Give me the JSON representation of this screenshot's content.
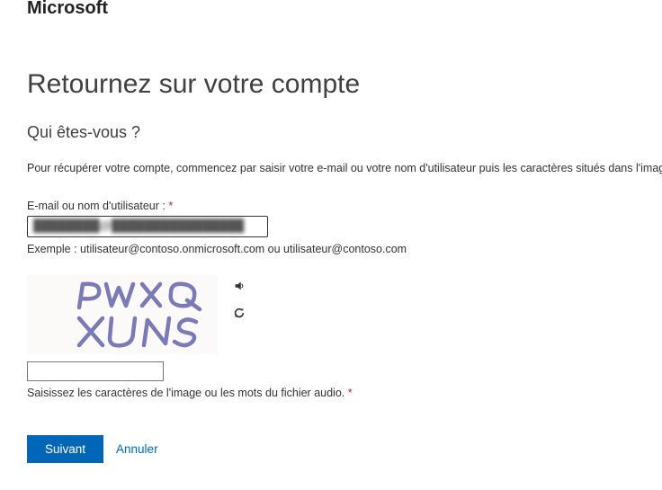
{
  "logo": "Microsoft",
  "page": {
    "title": "Retournez sur votre compte",
    "subtitle": "Qui êtes-vous ?",
    "instructions": "Pour récupérer votre compte, commencez par saisir votre e-mail ou votre nom d'utilisateur puis les caractères situés dans l'image o"
  },
  "email_field": {
    "label": "E-mail ou nom d'utilisateur :",
    "required_marker": " *",
    "value": "████████@████████████████",
    "example": "Exemple : utilisateur@contoso.onmicrosoft.com ou utilisateur@contoso.com"
  },
  "captcha": {
    "text": "PWXQ XUNS",
    "hint": "Saisissez les caractères de l'image ou les mots du fichier audio.",
    "required_marker": " *"
  },
  "buttons": {
    "next": "Suivant",
    "cancel": "Annuler"
  }
}
